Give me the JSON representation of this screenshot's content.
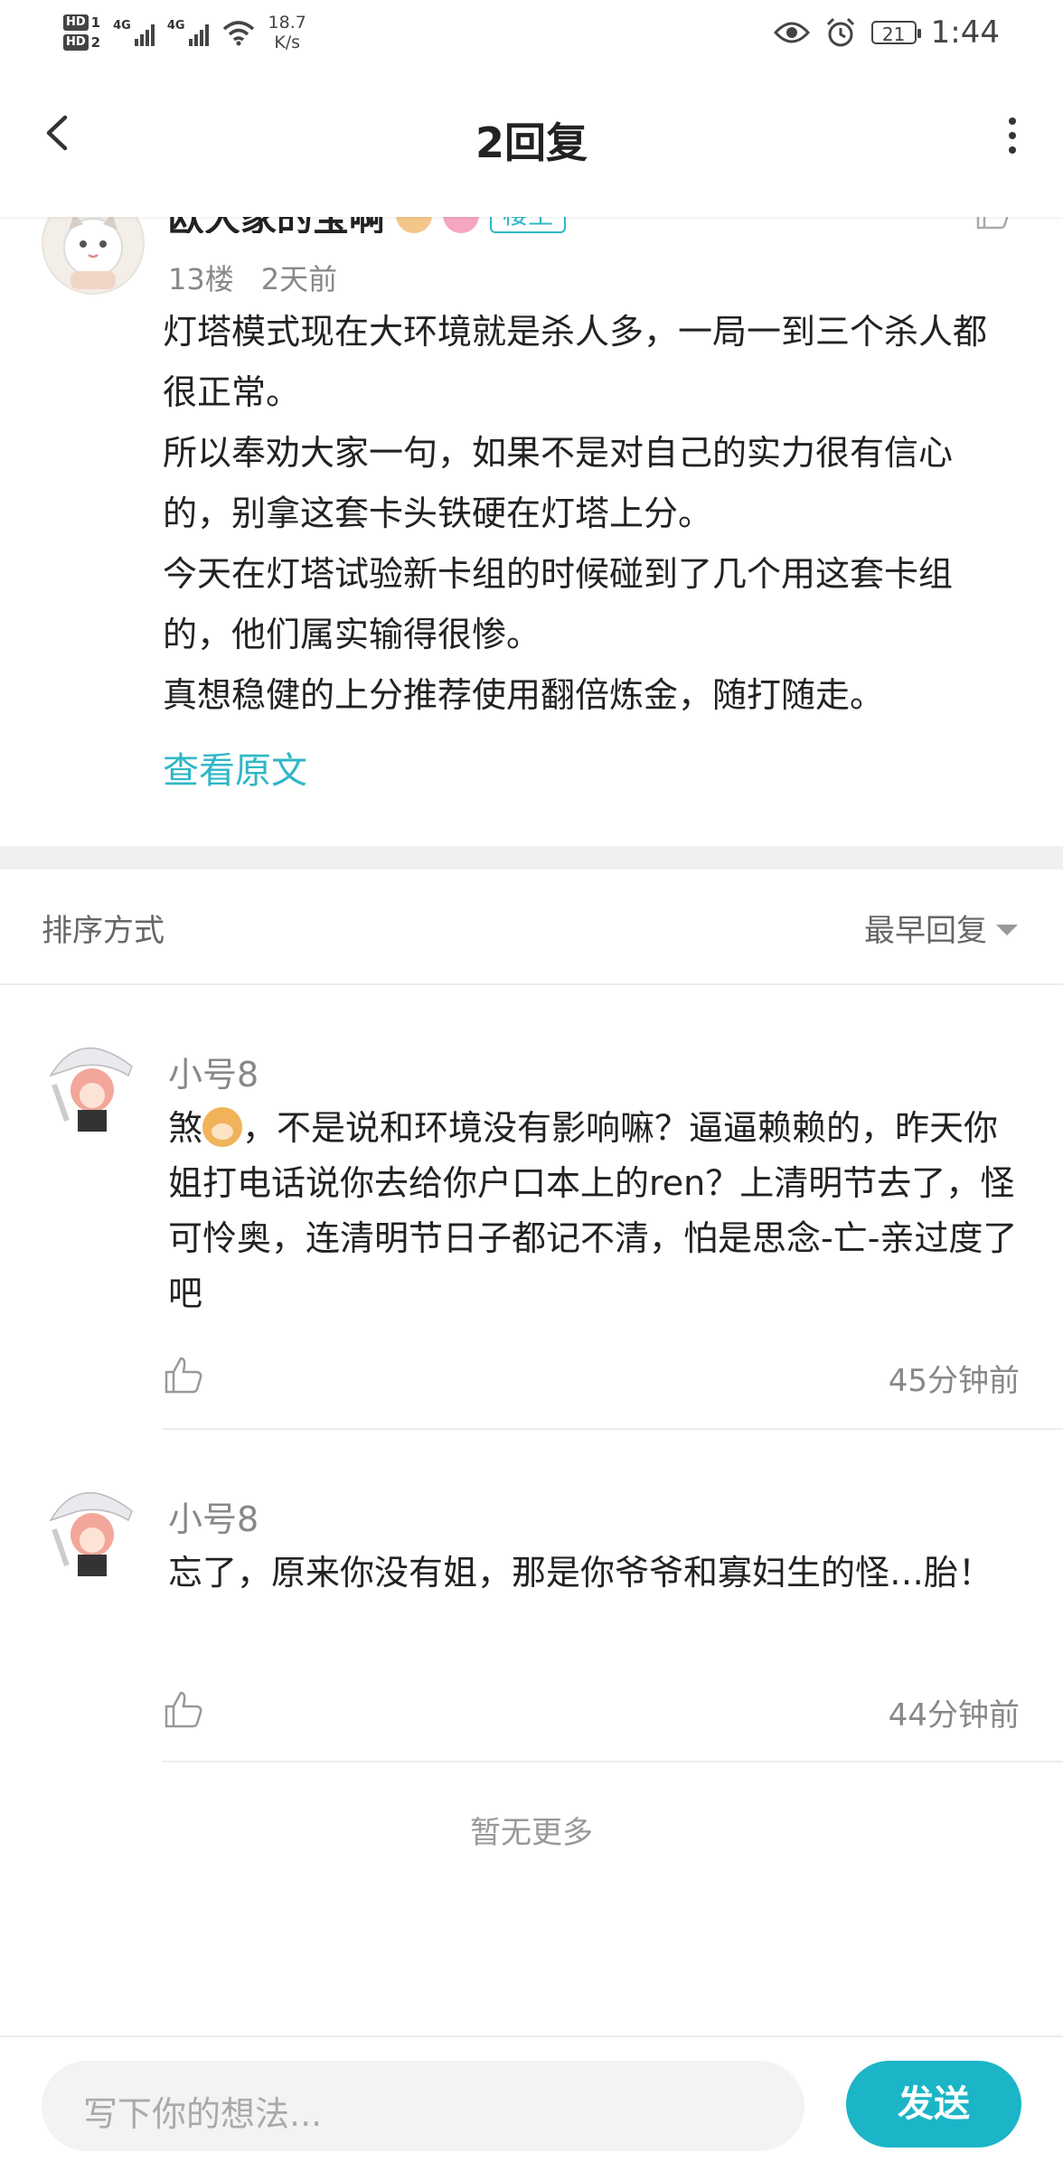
{
  "status_bar": {
    "hd1": "HD",
    "sim1": "1",
    "hd2": "HD",
    "sim2": "2",
    "net1": "4G",
    "net2": "4G",
    "speed_value": "18.7",
    "speed_unit": "K/s",
    "battery": "21",
    "time": "1:44"
  },
  "header": {
    "title": "2回复"
  },
  "original_post": {
    "author": "欧大家的宝啊",
    "badge_label": "楼主",
    "floor": "13楼",
    "time": "2天前",
    "paragraphs": [
      "灯塔模式现在大环境就是杀人多，一局一到三个杀人都很正常。",
      "所以奉劝大家一句，如果不是对自己的实力很有信心的，别拿这套卡头铁硬在灯塔上分。",
      "今天在灯塔试验新卡组的时候碰到了几个用这套卡组的，他们属实输得很惨。",
      "真想稳健的上分推荐使用翻倍炼金，随打随走。"
    ],
    "view_original": "查看原文"
  },
  "sort": {
    "label": "排序方式",
    "value": "最早回复"
  },
  "replies": [
    {
      "author": "小号8",
      "text_before_emoji": "煞",
      "text_after_emoji": "，不是说和环境没有影响嘛？逼逼赖赖的，昨天你姐打电话说你去给你户口本上的ren？上清明节去了，怪可怜奥，连清明节日子都记不清，怕是思念-亡-亲过度了吧",
      "time": "45分钟前"
    },
    {
      "author": "小号8",
      "text": "忘了，原来你没有姐，那是你爷爷和寡妇生的怪…胎！",
      "time": "44分钟前"
    }
  ],
  "footer_note": "暂无更多",
  "composer": {
    "placeholder": "写下你的想法...",
    "send_label": "发送"
  },
  "colors": {
    "accent": "#1bb5c7",
    "link": "#2fb7c6"
  }
}
